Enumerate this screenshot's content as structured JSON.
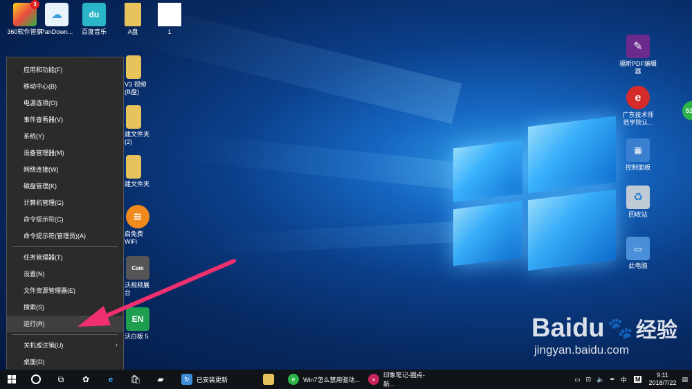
{
  "desktop_icons": [
    {
      "label": "360软件管家",
      "badge": "3",
      "icon": "360-software-icon",
      "color": "#e94b3c"
    },
    {
      "label": "PanDown...",
      "icon": "cloud-icon",
      "color": "#3aa0e0"
    },
    {
      "label": "百度音乐",
      "icon": "music-icon",
      "color": "#2bb5c8"
    },
    {
      "label": "A盘",
      "icon": "folder-icon",
      "color": "#e8c25a"
    },
    {
      "label": "1",
      "icon": "document-icon",
      "color": "#ffffff"
    }
  ],
  "partial_icons": [
    {
      "label": "V3 视频\n(B盘)",
      "icon": "folder-icon",
      "color": "#e8c25a"
    },
    {
      "label": "建文件夹\n(2)",
      "icon": "folder-icon",
      "color": "#e8c25a"
    },
    {
      "label": "建文件夹",
      "icon": "folder-icon",
      "color": "#e8c25a"
    },
    {
      "label": "启免费\nWiFi",
      "icon": "wifi-icon",
      "color": "#f08a1c"
    },
    {
      "label": "沃视频展\n台",
      "icon": "camera-icon",
      "color": "#555555"
    },
    {
      "label": "沃白板 5",
      "icon": "whiteboard-icon",
      "color": "#1e9e4f"
    }
  ],
  "right_icons": [
    {
      "label": "福昕PDF编辑\n器",
      "icon": "pdf-icon",
      "color": "#6b2a8c"
    },
    {
      "label": "广东技术师\n范学院认...",
      "icon": "browser-icon",
      "color": "#d62b2b"
    },
    {
      "label": "控制面板",
      "icon": "control-panel-icon",
      "color": "#3b7fd0"
    },
    {
      "label": "回收站",
      "icon": "recycle-bin-icon",
      "color": "#bfcad6"
    },
    {
      "label": "此电脑",
      "icon": "computer-icon",
      "color": "#4a90d9"
    }
  ],
  "context_menu": {
    "group1": [
      "应用和功能(F)",
      "移动中心(B)",
      "电源选项(O)",
      "事件查看器(V)",
      "系统(Y)",
      "设备管理器(M)",
      "网络连接(W)",
      "磁盘管理(K)",
      "计算机管理(G)",
      "命令提示符(C)",
      "命令提示符(管理员)(A)"
    ],
    "group2": [
      "任务管理器(T)",
      "设置(N)",
      "文件资源管理器(E)",
      "搜索(S)",
      "运行(R)"
    ],
    "group3": [
      "关机或注销(U)",
      "桌面(D)"
    ],
    "highlighted": "运行(R)"
  },
  "taskbar": {
    "tasks": [
      {
        "label": "已安装更新",
        "icon": "update-icon",
        "color": "#3c8dd6"
      },
      {
        "label": "",
        "icon": "explorer-icon",
        "color": "#e8c25a"
      },
      {
        "label": "Win7怎么禁用驱动...",
        "icon": "browser-360-icon",
        "color": "#2db34a"
      },
      {
        "label": "印象笔记-圈点-新...",
        "icon": "evernote-icon",
        "color": "#c8235a"
      }
    ],
    "tray": {
      "ime": "中",
      "ime_mode": "M",
      "time": "9:11",
      "date": "2018/7/22"
    }
  },
  "watermark": {
    "brand": "Baidu",
    "brand_cn": "经验",
    "url": "jingyan.baidu.com"
  },
  "edge_badge": "51"
}
